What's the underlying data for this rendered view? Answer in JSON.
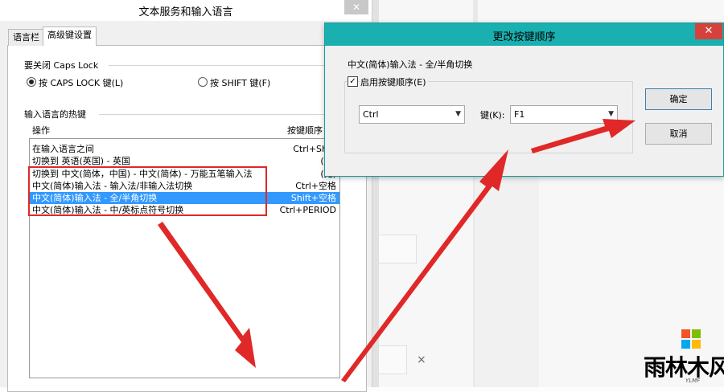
{
  "main_dialog": {
    "title": "文本服务和输入语言",
    "close": "✕",
    "tabs": [
      {
        "label": "语言栏",
        "active": false
      },
      {
        "label": "高级键设置",
        "active": true
      }
    ],
    "caps_lock": {
      "group_title": "要关闭 Caps Lock",
      "options": [
        {
          "label": "按 CAPS LOCK 键(L)",
          "selected": true
        },
        {
          "label": "按 SHIFT 键(F)",
          "selected": false
        }
      ]
    },
    "hotkeys": {
      "group_title": "输入语言的热键",
      "col_action": "操作",
      "col_hotkey": "按键顺序",
      "rows": [
        {
          "action": "在输入语言之间",
          "hotkey": "Ctrl+Shift"
        },
        {
          "action": "切换到 英语(英国) - 英国",
          "hotkey": "(无)"
        },
        {
          "action": "切换到 中文(简体，中国) - 中文(简体) - 万能五笔输入法",
          "hotkey": "(无)"
        },
        {
          "action": "中文(简体)输入法 - 输入法/非输入法切换",
          "hotkey": "Ctrl+空格"
        },
        {
          "action": "中文(简体)输入法 - 全/半角切换",
          "hotkey": "Shift+空格",
          "selected": true
        },
        {
          "action": "中文(简体)输入法 - 中/英标点符号切换",
          "hotkey": "Ctrl+PERIOD"
        }
      ]
    }
  },
  "key_dialog": {
    "title": "更改按键顺序",
    "close": "✕",
    "description": "中文(简体)输入法 - 全/半角切换",
    "enable_checkbox": {
      "label": "启用按键顺序(E)",
      "checked": true,
      "mark": "✓"
    },
    "modifier_value": "Ctrl",
    "key_label": "键(K):",
    "key_value": "F1",
    "dropdown_glyph": "▼",
    "ok_label": "确定",
    "cancel_label": "取消"
  },
  "background": {
    "close_mark": "×"
  },
  "watermark": {
    "text": "雨林木风",
    "sub": "YLMF"
  },
  "colors": {
    "titlebar_accent": "#1ab0b0",
    "close_red": "#d6413c",
    "selection": "#3399ff",
    "annotation_red": "#e02828",
    "win_logo": [
      "#f35325",
      "#81bc06",
      "#05a6f0",
      "#ffba08"
    ]
  }
}
